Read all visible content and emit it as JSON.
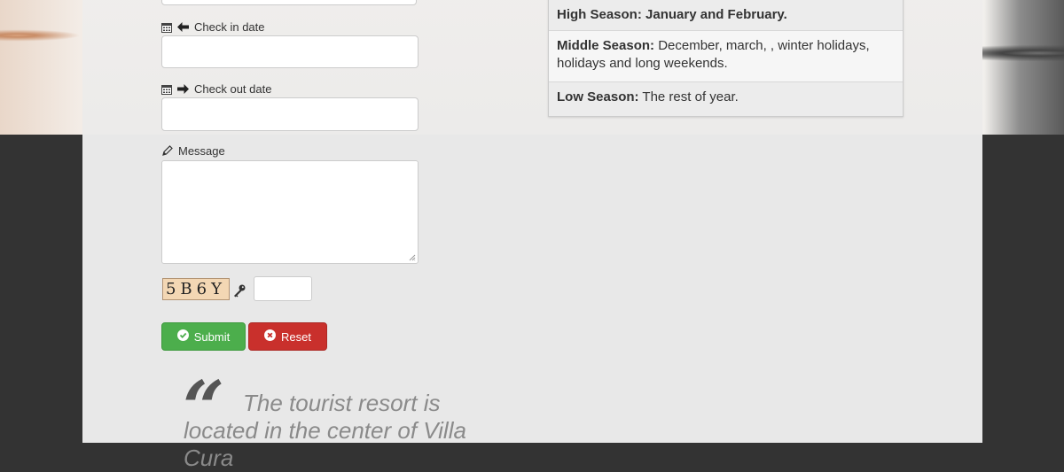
{
  "form": {
    "checkin_label": "Check in date",
    "checkout_label": "Check out date",
    "message_label": "Message",
    "checkin_value": "",
    "checkout_value": "",
    "message_value": "",
    "captcha_text": "5B6Y",
    "captcha_value": "",
    "submit_label": "Submit",
    "reset_label": "Reset"
  },
  "seasons": [
    {
      "title": "High Season:",
      "text": " January and February."
    },
    {
      "title": "Middle Season:",
      "text": " December, march, , winter holidays, holidays and long weekends."
    },
    {
      "title": "Low Season:",
      "text": " The rest of year."
    }
  ],
  "quote": {
    "text_line1": "The tourist resort is",
    "text_line2": "located in the center of Villa Cura"
  },
  "colors": {
    "submit": "#4cae4c",
    "reset": "#c9302c",
    "page_bg": "#e8e8e8",
    "dark_bg": "#333333"
  },
  "icons": [
    "calendar-icon",
    "arrow-left-icon",
    "arrow-right-icon",
    "pencil-icon",
    "key-icon",
    "check-circle-icon",
    "x-circle-icon",
    "quote-icon"
  ]
}
